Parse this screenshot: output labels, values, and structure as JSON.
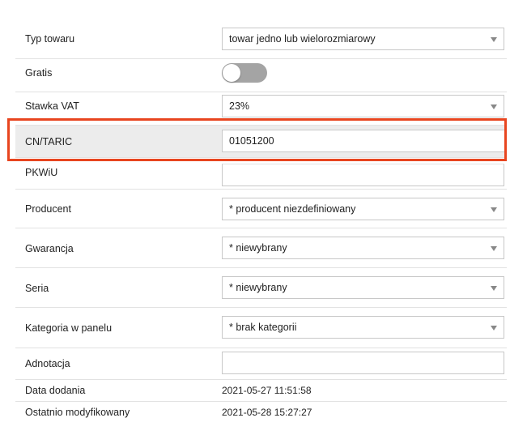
{
  "fields": {
    "typ_towaru": {
      "label": "Typ towaru",
      "value": "towar jedno lub wielorozmiarowy"
    },
    "gratis": {
      "label": "Gratis",
      "enabled": false
    },
    "stawka_vat": {
      "label": "Stawka VAT",
      "value": "23%"
    },
    "cn_taric": {
      "label": "CN/TARIC",
      "value": "01051200"
    },
    "pkwiu": {
      "label": "PKWiU",
      "value": ""
    },
    "producent": {
      "label": "Producent",
      "value": "* producent niezdefiniowany"
    },
    "gwarancja": {
      "label": "Gwarancja",
      "value": "* niewybrany"
    },
    "seria": {
      "label": "Seria",
      "value": "* niewybrany"
    },
    "kategoria_w_panelu": {
      "label": "Kategoria w panelu",
      "value": "* brak kategorii"
    },
    "adnotacja": {
      "label": "Adnotacja",
      "value": ""
    },
    "data_dodania": {
      "label": "Data dodania",
      "value": "2021-05-27 11:51:58"
    },
    "ostatnio_modyfikowany": {
      "label": "Ostatnio modyfikowany",
      "value": "2021-05-28 15:27:27"
    }
  },
  "colors": {
    "highlight_border": "#e8451f",
    "highlight_row_bg": "#ececec",
    "toggle_off": "#a4a4a4"
  }
}
